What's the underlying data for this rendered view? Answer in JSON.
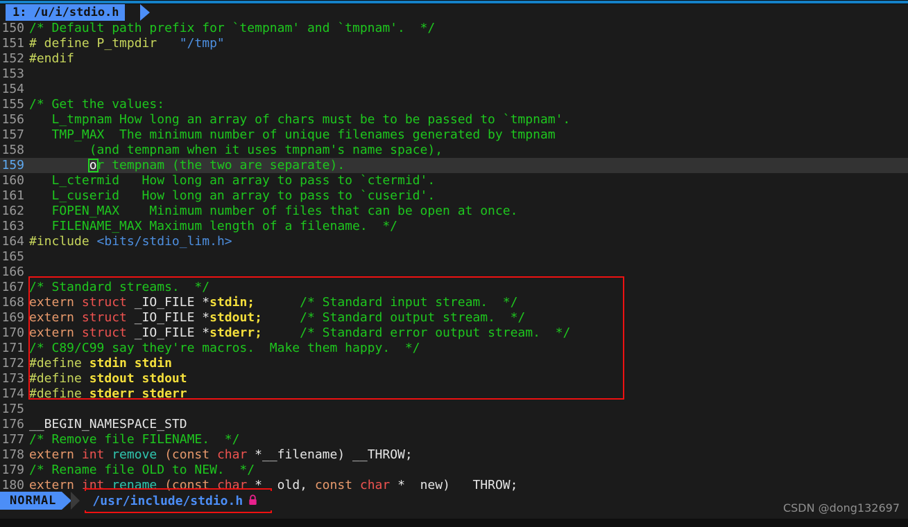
{
  "window": {
    "accent_blue": "#4c8ef7",
    "background": "#1b1b1b",
    "annotation_red": "#ee1111"
  },
  "tabline": {
    "tab_label": "1: /u/i/stdio.h"
  },
  "editor": {
    "cursor_line": 159,
    "cursor_char": "o",
    "lines": [
      {
        "num": "150",
        "tokens": [
          {
            "t": "/* Default path prefix for `tempnam' and `tmpnam'.  */",
            "c": "cmt"
          }
        ]
      },
      {
        "num": "151",
        "tokens": [
          {
            "t": "# define P_tmpdir   ",
            "c": "pre"
          },
          {
            "t": "\"/tmp\"",
            "c": "str"
          }
        ]
      },
      {
        "num": "152",
        "tokens": [
          {
            "t": "#endif",
            "c": "pre"
          }
        ]
      },
      {
        "num": "153",
        "tokens": []
      },
      {
        "num": "154",
        "tokens": []
      },
      {
        "num": "155",
        "tokens": [
          {
            "t": "/* Get the values:",
            "c": "cmt"
          }
        ]
      },
      {
        "num": "156",
        "tokens": [
          {
            "t": "   L_tmpnam How long an array of chars must be to be passed to `tmpnam'.",
            "c": "cmt"
          }
        ]
      },
      {
        "num": "157",
        "tokens": [
          {
            "t": "   TMP_MAX  The minimum number of unique filenames generated by tmpnam",
            "c": "cmt"
          }
        ]
      },
      {
        "num": "158",
        "tokens": [
          {
            "t": "        (and tempnam when it uses tmpnam's name space),",
            "c": "cmt"
          }
        ]
      },
      {
        "num": "159",
        "cursor": true,
        "tokens": [
          {
            "t": "        ",
            "c": "cmt"
          },
          {
            "t": "o",
            "c": "cursorblock"
          },
          {
            "t": "r tempnam (the two are separate).",
            "c": "cmt"
          }
        ]
      },
      {
        "num": "160",
        "tokens": [
          {
            "t": "   L_ctermid   How long an array to pass to `ctermid'.",
            "c": "cmt"
          }
        ]
      },
      {
        "num": "161",
        "tokens": [
          {
            "t": "   L_cuserid   How long an array to pass to `cuserid'.",
            "c": "cmt"
          }
        ]
      },
      {
        "num": "162",
        "tokens": [
          {
            "t": "   FOPEN_MAX    Minimum number of files that can be open at once.",
            "c": "cmt"
          }
        ]
      },
      {
        "num": "163",
        "tokens": [
          {
            "t": "   FILENAME_MAX Maximum length of a filename.  */",
            "c": "cmt"
          }
        ]
      },
      {
        "num": "164",
        "tokens": [
          {
            "t": "#include ",
            "c": "pre"
          },
          {
            "t": "<bits/stdio_lim.h>",
            "c": "inc"
          }
        ]
      },
      {
        "num": "165",
        "tokens": []
      },
      {
        "num": "166",
        "tokens": []
      },
      {
        "num": "167",
        "tokens": [
          {
            "t": "/* Standard streams.  */",
            "c": "cmt"
          }
        ]
      },
      {
        "num": "168",
        "tokens": [
          {
            "t": "extern ",
            "c": "typ"
          },
          {
            "t": "struct ",
            "c": "kw"
          },
          {
            "t": "_IO_FILE ",
            "c": "plain"
          },
          {
            "t": "*",
            "c": "plain"
          },
          {
            "t": "stdin;",
            "c": "mac"
          },
          {
            "t": "      ",
            "c": "plain"
          },
          {
            "t": "/* Standard input stream.  */",
            "c": "cmt"
          }
        ]
      },
      {
        "num": "169",
        "tokens": [
          {
            "t": "extern ",
            "c": "typ"
          },
          {
            "t": "struct ",
            "c": "kw"
          },
          {
            "t": "_IO_FILE ",
            "c": "plain"
          },
          {
            "t": "*",
            "c": "plain"
          },
          {
            "t": "stdout;",
            "c": "mac"
          },
          {
            "t": "     ",
            "c": "plain"
          },
          {
            "t": "/* Standard output stream.  */",
            "c": "cmt"
          }
        ]
      },
      {
        "num": "170",
        "tokens": [
          {
            "t": "extern ",
            "c": "typ"
          },
          {
            "t": "struct ",
            "c": "kw"
          },
          {
            "t": "_IO_FILE ",
            "c": "plain"
          },
          {
            "t": "*",
            "c": "plain"
          },
          {
            "t": "stderr;",
            "c": "mac"
          },
          {
            "t": "     ",
            "c": "plain"
          },
          {
            "t": "/* Standard error output stream.  */",
            "c": "cmt"
          }
        ]
      },
      {
        "num": "171",
        "tokens": [
          {
            "t": "/* C89/C99 say they're macros.  Make them happy.  */",
            "c": "cmt"
          }
        ]
      },
      {
        "num": "172",
        "tokens": [
          {
            "t": "#define ",
            "c": "pre"
          },
          {
            "t": "stdin stdin",
            "c": "mac"
          }
        ]
      },
      {
        "num": "173",
        "tokens": [
          {
            "t": "#define ",
            "c": "pre"
          },
          {
            "t": "stdout stdout",
            "c": "mac"
          }
        ]
      },
      {
        "num": "174",
        "tokens": [
          {
            "t": "#define ",
            "c": "pre"
          },
          {
            "t": "stderr stderr",
            "c": "mac"
          }
        ]
      },
      {
        "num": "175",
        "tokens": []
      },
      {
        "num": "176",
        "tokens": [
          {
            "t": "__BEGIN_NAMESPACE_STD",
            "c": "plain"
          }
        ]
      },
      {
        "num": "177",
        "tokens": [
          {
            "t": "/* Remove file FILENAME.  */",
            "c": "cmt"
          }
        ]
      },
      {
        "num": "178",
        "tokens": [
          {
            "t": "extern ",
            "c": "typ"
          },
          {
            "t": "int ",
            "c": "kw"
          },
          {
            "t": "remove ",
            "c": "fn"
          },
          {
            "t": "(",
            "c": "typ"
          },
          {
            "t": "const ",
            "c": "typ"
          },
          {
            "t": "char ",
            "c": "kw"
          },
          {
            "t": "*",
            "c": "plain"
          },
          {
            "t": "__filename) __THROW;",
            "c": "plain"
          }
        ]
      },
      {
        "num": "179",
        "tokens": [
          {
            "t": "/* Rename file OLD to NEW.  */",
            "c": "cmt"
          }
        ]
      },
      {
        "num": "180",
        "tokens": [
          {
            "t": "extern ",
            "c": "typ"
          },
          {
            "t": "int ",
            "c": "kw"
          },
          {
            "t": "rename ",
            "c": "fn"
          },
          {
            "t": "(",
            "c": "typ"
          },
          {
            "t": "const ",
            "c": "typ"
          },
          {
            "t": "char ",
            "c": "kw"
          },
          {
            "t": "*",
            "c": "plain"
          },
          {
            "t": "__old, ",
            "c": "plain"
          },
          {
            "t": "const ",
            "c": "typ"
          },
          {
            "t": "char ",
            "c": "kw"
          },
          {
            "t": "*",
            "c": "plain"
          },
          {
            "t": "__new) __THROW;",
            "c": "plain"
          }
        ]
      }
    ]
  },
  "annotations": {
    "streams_box_label": "standard-streams-highlight",
    "status_box_label": "file-path-highlight"
  },
  "statusbar": {
    "mode": "NORMAL",
    "file_path": "/usr/include/stdio.h",
    "lock_icon": "lock-icon",
    "lock_glyph": "🔒"
  },
  "watermark": {
    "text": "CSDN @dong132697"
  }
}
